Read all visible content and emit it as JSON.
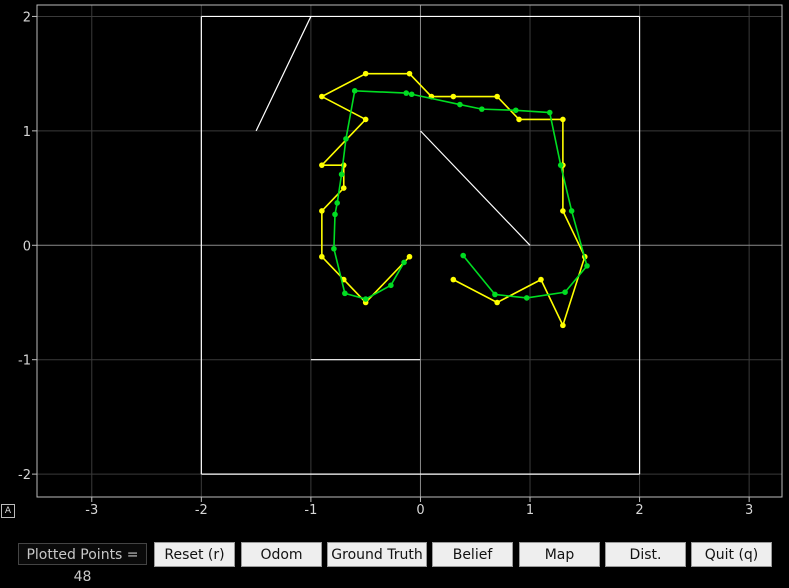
{
  "chart_data": {
    "type": "line",
    "xlim": [
      -3.5,
      3.3
    ],
    "ylim": [
      -2.2,
      2.1
    ],
    "xticks": [
      -3,
      -2,
      -1,
      0,
      1,
      2,
      3
    ],
    "yticks": [
      2,
      1,
      0,
      -1,
      -2
    ],
    "grid": true,
    "map_segments": [
      [
        [
          -2,
          -2
        ],
        [
          2,
          -2
        ]
      ],
      [
        [
          2,
          -2
        ],
        [
          2,
          2
        ]
      ],
      [
        [
          2,
          2
        ],
        [
          -2,
          2
        ]
      ],
      [
        [
          -2,
          2
        ],
        [
          -2,
          -2
        ]
      ],
      [
        [
          -1,
          2
        ],
        [
          -1.5,
          1
        ]
      ],
      [
        [
          0,
          1
        ],
        [
          1,
          0
        ]
      ],
      [
        [
          -1,
          -1
        ],
        [
          0,
          -1
        ]
      ]
    ],
    "series": [
      {
        "color": "#ffff00",
        "points": [
          [
            -0.1,
            -0.1
          ],
          [
            -0.5,
            -0.5
          ],
          [
            -0.7,
            -0.3
          ],
          [
            -0.9,
            -0.1
          ],
          [
            -0.9,
            0.3
          ],
          [
            -0.7,
            0.5
          ],
          [
            -0.7,
            0.7
          ],
          [
            -0.9,
            0.7
          ],
          [
            -0.5,
            1.1
          ],
          [
            -0.9,
            1.3
          ],
          [
            -0.5,
            1.5
          ],
          [
            -0.1,
            1.5
          ],
          [
            0.1,
            1.3
          ],
          [
            0.3,
            1.3
          ],
          [
            0.7,
            1.3
          ],
          [
            0.9,
            1.1
          ],
          [
            1.3,
            1.1
          ],
          [
            1.3,
            0.7
          ],
          [
            1.3,
            0.3
          ],
          [
            1.5,
            -0.1
          ],
          [
            1.3,
            -0.7
          ],
          [
            1.1,
            -0.3
          ],
          [
            0.7,
            -0.5
          ],
          [
            0.3,
            -0.3
          ]
        ]
      },
      {
        "color": "#00dd22",
        "points": [
          [
            -0.15,
            -0.15
          ],
          [
            -0.27,
            -0.35
          ],
          [
            -0.5,
            -0.47
          ],
          [
            -0.69,
            -0.42
          ],
          [
            -0.79,
            -0.03
          ],
          [
            -0.78,
            0.27
          ],
          [
            -0.76,
            0.37
          ],
          [
            -0.72,
            0.62
          ],
          [
            -0.68,
            0.93
          ],
          [
            -0.6,
            1.35
          ],
          [
            -0.13,
            1.33
          ],
          [
            -0.08,
            1.32
          ],
          [
            0.36,
            1.23
          ],
          [
            0.56,
            1.19
          ],
          [
            0.87,
            1.18
          ],
          [
            1.18,
            1.16
          ],
          [
            1.28,
            0.7
          ],
          [
            1.38,
            0.3
          ],
          [
            1.52,
            -0.18
          ],
          [
            1.32,
            -0.41
          ],
          [
            0.97,
            -0.46
          ],
          [
            0.68,
            -0.43
          ],
          [
            0.39,
            -0.09
          ]
        ]
      }
    ]
  },
  "status": {
    "plotted_points": "Plotted Points = 48"
  },
  "autoscale_label": "A",
  "buttons": {
    "reset": "Reset (r)",
    "odom": "Odom",
    "ground_truth": "Ground Truth",
    "belief": "Belief",
    "map": "Map",
    "dist": "Dist.",
    "quit": "Quit (q)"
  }
}
